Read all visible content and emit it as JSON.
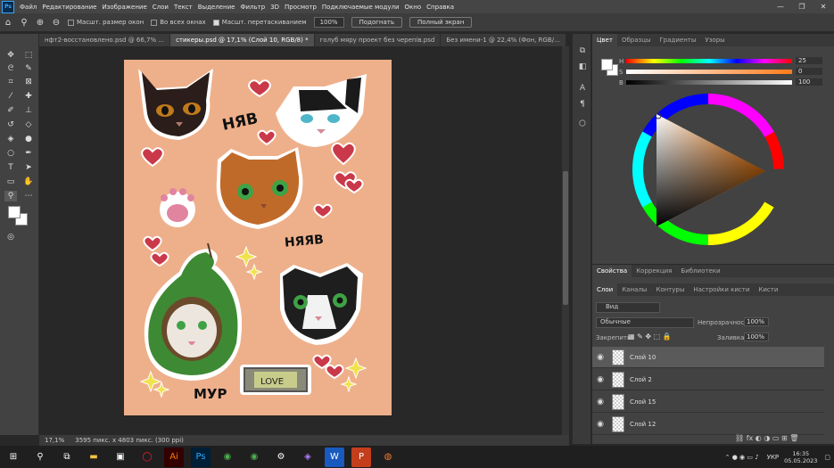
{
  "menu": {
    "logo": "Ps",
    "items": [
      "Файл",
      "Редактирование",
      "Изображение",
      "Слои",
      "Текст",
      "Выделение",
      "Фильтр",
      "3D",
      "Просмотр",
      "Подключаемые модули",
      "Окно",
      "Справка"
    ],
    "window_buttons": [
      "—",
      "❐",
      "✕"
    ]
  },
  "options": {
    "resize_windows": "Масшт. размер окон",
    "all_windows": "Во всех окнах",
    "scrubby_zoom": "Масшт. перетаскиванием",
    "zoom_value": "100%",
    "fit_button": "Подогнать",
    "fullscreen_button": "Полный экран"
  },
  "tabs": [
    {
      "label": "нфт2-восстановлено.psd @ 66,7% ...",
      "active": false
    },
    {
      "label": "стикеры.psd @ 17,1% (Слой 10, RGB/8) *",
      "active": true
    },
    {
      "label": "голуб мяру проект без черепів.psd",
      "active": false
    },
    {
      "label": "Без имени-1 @ 22,4% (Фон, RGB/...",
      "active": false
    }
  ],
  "document": {
    "background": "#eeb08b",
    "texts": [
      "НЯВ",
      "НЯЯВ",
      "МУР",
      "LOVE"
    ]
  },
  "status": {
    "zoom": "17,1%",
    "dimensions": "3595 пикс. х 4803 пикс. (300 ppi)"
  },
  "color_panel": {
    "tabs": [
      "Цвет",
      "Образцы",
      "Градиенты",
      "Узоры"
    ],
    "sliders": [
      {
        "label": "H",
        "value": "25"
      },
      {
        "label": "S",
        "value": "0"
      },
      {
        "label": "B",
        "value": "100"
      }
    ]
  },
  "props_tabs": [
    "Свойства",
    "Коррекция",
    "Библиотеки"
  ],
  "layers_panel": {
    "tabs": [
      "Слои",
      "Каналы",
      "Контуры",
      "Настройки кисти",
      "Кисти"
    ],
    "kind": "Вид",
    "blend_mode": "Обычные",
    "opacity_label": "Непрозрачность:",
    "opacity_value": "100%",
    "lock_label": "Закрепить:",
    "fill_label": "Заливка:",
    "fill_value": "100%",
    "layers": [
      {
        "name": "Слой 10",
        "selected": true
      },
      {
        "name": "Слой 2",
        "selected": false
      },
      {
        "name": "Слой 15",
        "selected": false
      },
      {
        "name": "Слой 12",
        "selected": false
      }
    ]
  },
  "taskbar": {
    "language": "УКР",
    "time": "16:35",
    "date": "05.05.2023"
  },
  "colors": {
    "accent": "#31a8ff",
    "selected_layer": "#5a5a5a",
    "foreground": "#ffffff",
    "background": "#ffffff"
  }
}
